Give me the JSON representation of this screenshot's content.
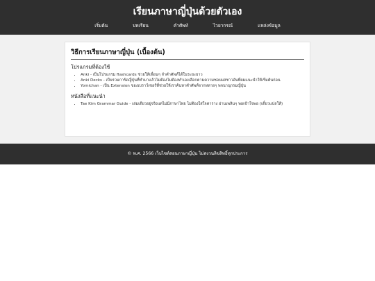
{
  "header": {
    "title": "เรียนภาษาญี่ปุ่นด้วยตัวเอง",
    "nav": [
      "เริ่มต้น",
      "บทเรียน",
      "คำศัพท์",
      "ไวยากรณ์",
      "แหล่งข้อมูล"
    ]
  },
  "article": {
    "title": "วิธีการเรียนภาษาญี่ปุ่น (เบื้องต้น)",
    "section1": {
      "heading": "โปรแกรมที่ต้องใช้",
      "items": [
        "Anki - เป็นโปรแกรม flashcards ช่วยให้เพื่อนๆ จำคำศัพท์ได้ในระยะยาว",
        "Anki Decks - เป็นรวมการ์ดญี่ปุ่นที่ทำมาแล้วไม่ต้องไม่ต้องทำเองเลือกตามความชอบผสชาวอันที่ผมแนะนำให้เริ่มต้นก่อน",
        "Yomichan - เป็น Extension ของเบราว์เซอร์ที่ช่วยให้เราค้นหาคำศัพท์จากหลายๆ พจนานุกรมญี่ปุ่น"
      ]
    },
    "section2": {
      "heading": "หนังสือที่แนะนำ",
      "items": [
        "Tae Kim Grammar Guide - เล่มเดียวอยู่จริงแต่ไม่มีภาษาไทย ไม่ต้องใส่ใจตาราง อ่านเพลินๆ พอเข้าใจพอ (เดี๋ยวแปลให้)"
      ]
    }
  },
  "footer": {
    "text": "© พ.ศ. 2566 เว็บไซต์สอนภาษาญี่ปุ่น ไม่สงวนลิขสิทธิ์ทุกประการ"
  }
}
